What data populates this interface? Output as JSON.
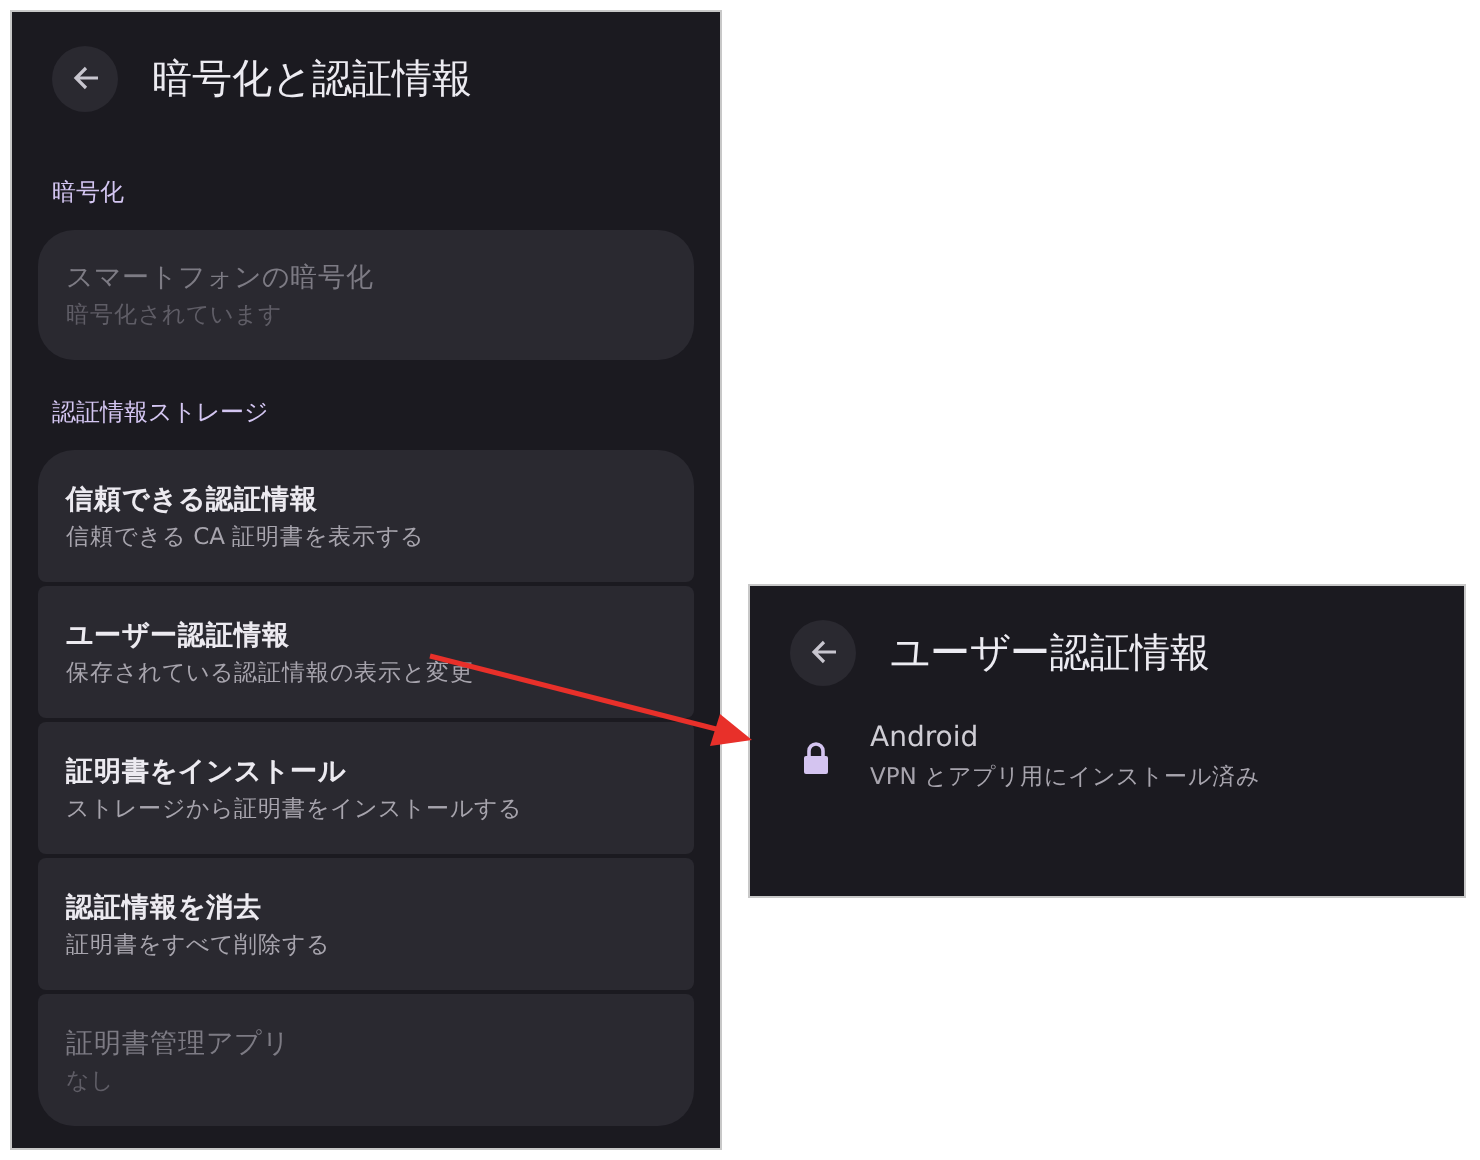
{
  "settings_screen": {
    "title": "暗号化と認証情報",
    "sections": [
      {
        "heading": "暗号化",
        "items": [
          {
            "title": "スマートフォンの暗号化",
            "subtitle": "暗号化されています",
            "disabled": true
          }
        ]
      },
      {
        "heading": "認証情報ストレージ",
        "items": [
          {
            "title": "信頼できる認証情報",
            "subtitle": "信頼できる CA 証明書を表示する",
            "disabled": false
          },
          {
            "title": "ユーザー認証情報",
            "subtitle": "保存されている認証情報の表示と変更",
            "disabled": false
          },
          {
            "title": "証明書をインストール",
            "subtitle": "ストレージから証明書をインストールする",
            "disabled": false
          },
          {
            "title": "認証情報を消去",
            "subtitle": "証明書をすべて削除する",
            "disabled": false
          },
          {
            "title": "証明書管理アプリ",
            "subtitle": "なし",
            "disabled": true
          }
        ]
      }
    ]
  },
  "detail_screen": {
    "title": "ユーザー認証情報",
    "items": [
      {
        "title": "Android",
        "subtitle": "VPN とアプリ用にインストール済み"
      }
    ]
  }
}
